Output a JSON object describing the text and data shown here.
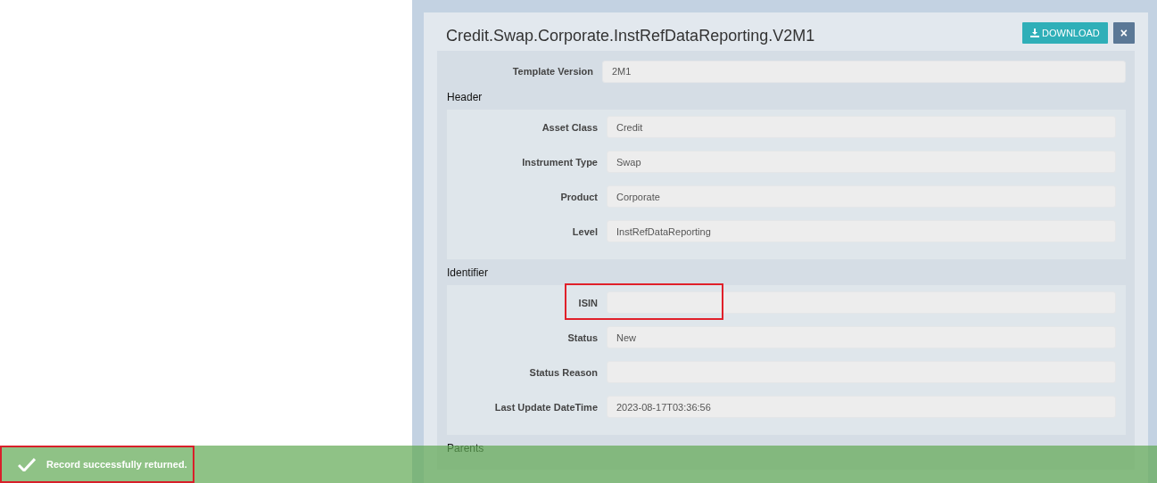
{
  "dialog": {
    "title": "Credit.Swap.Corporate.InstRefDataReporting.V2M1",
    "buttons": [
      {
        "kind": "download",
        "label": "DOWNLOAD"
      },
      {
        "kind": "close",
        "label": "×"
      }
    ]
  },
  "top_fields": [
    {
      "label": "Template Version",
      "value": "2M1",
      "highlighted": false
    }
  ],
  "sections": [
    {
      "title": "Header",
      "fields": [
        {
          "label": "Asset Class",
          "value": "Credit",
          "highlighted": false
        },
        {
          "label": "Instrument Type",
          "value": "Swap",
          "highlighted": false
        },
        {
          "label": "Product",
          "value": "Corporate",
          "highlighted": false
        },
        {
          "label": "Level",
          "value": "InstRefDataReporting",
          "highlighted": false
        }
      ]
    },
    {
      "title": "Identifier",
      "fields": [
        {
          "label": "ISIN",
          "highlighted": true
        },
        {
          "label": "Status",
          "value": "New",
          "highlighted": false
        },
        {
          "label": "Status Reason",
          "highlighted": false
        },
        {
          "label": "Last Update DateTime",
          "value": "2023-08-17T03:36:56",
          "highlighted": false
        }
      ]
    },
    {
      "title": "Parents"
    }
  ],
  "toast": {
    "message": "Record successfully returned.",
    "highlighted": true
  }
}
